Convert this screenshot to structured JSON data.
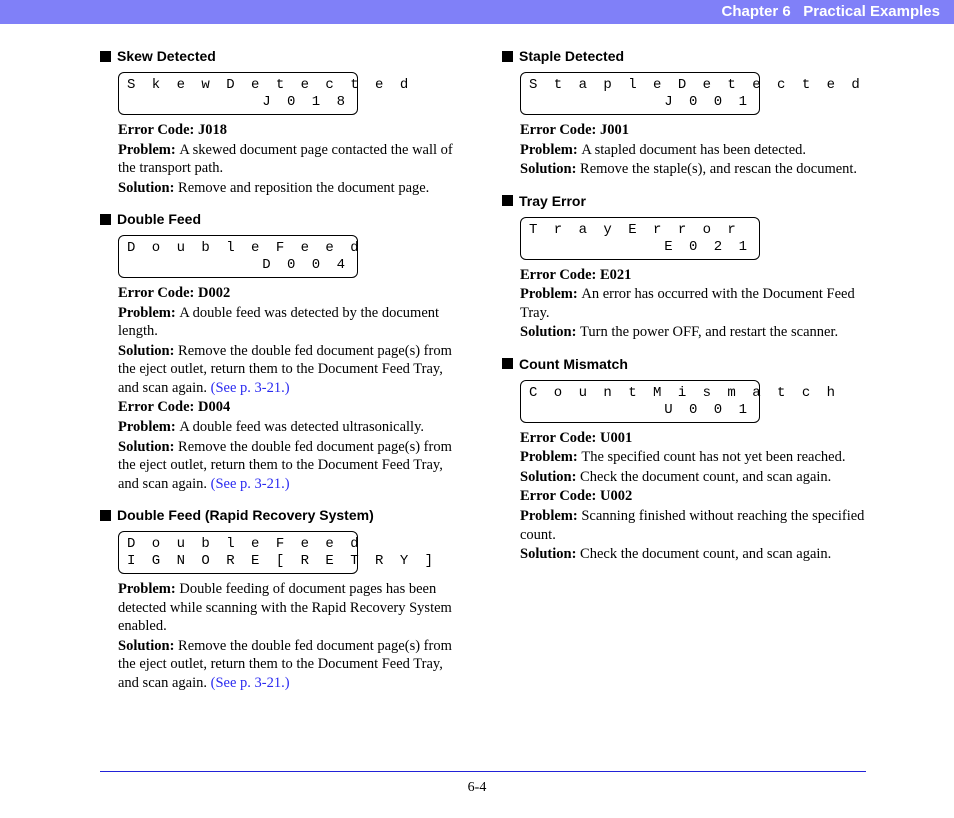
{
  "header": {
    "chapter": "Chapter 6",
    "title": "Practical Examples"
  },
  "footer": {
    "page": "6-4"
  },
  "seeRef": "(See p. 3-21.)",
  "left": [
    {
      "heading": "Skew Detected",
      "lcd": [
        "Skew Detected",
        ""
      ],
      "lcdR": [
        "",
        "J018"
      ],
      "blocks": [
        {
          "ec": "Error Code: J018",
          "p": "A skewed document page contacted the wall of the transport path.",
          "s": "Remove and reposition the document page."
        }
      ]
    },
    {
      "heading": "Double Feed",
      "lcd": [
        "Double Feed",
        ""
      ],
      "lcdR": [
        "",
        "D004"
      ],
      "blocks": [
        {
          "ec": "Error Code: D002",
          "p": "A double feed was detected by the document length.",
          "s": "Remove the double fed document page(s) from the eject outlet, return them to the Document Feed Tray, and scan again. ",
          "see": true
        },
        {
          "ec": "Error Code: D004",
          "p": "A double feed was detected ultrasonically.",
          "s": "Remove the double fed document page(s) from the eject outlet, return them to the Document Feed Tray, and scan again. ",
          "see": true
        }
      ]
    },
    {
      "heading": "Double Feed (Rapid Recovery System)",
      "lcd": [
        "Double Feed",
        " IGNORE [RETRY]"
      ],
      "lcdR": [
        "",
        ""
      ],
      "blocks": [
        {
          "ec": "",
          "p": "Double feeding of document pages has been detected while scanning with the Rapid Recovery System enabled.",
          "s": "Remove the double fed document page(s) from the eject outlet, return them to the Document Feed Tray, and scan again. ",
          "see": true
        }
      ]
    }
  ],
  "right": [
    {
      "heading": "Staple Detected",
      "lcd": [
        "Staple Detected",
        ""
      ],
      "lcdR": [
        "",
        "J001"
      ],
      "blocks": [
        {
          "ec": "Error Code: J001",
          "p": "A stapled document has been detected.",
          "s": "Remove the staple(s), and rescan the document."
        }
      ]
    },
    {
      "heading": "Tray Error",
      "lcd": [
        "Tray Error",
        ""
      ],
      "lcdR": [
        "",
        "E021"
      ],
      "blocks": [
        {
          "ec": "Error Code: E021",
          "p": "An error has occurred with the Document Feed Tray.",
          "s": "Turn the power OFF, and restart the scanner."
        }
      ]
    },
    {
      "heading": "Count Mismatch",
      "lcd": [
        "Count Mismatch",
        ""
      ],
      "lcdR": [
        "",
        "U001"
      ],
      "blocks": [
        {
          "ec": "Error Code: U001",
          "p": "The specified count has not yet been reached.",
          "s": "Check the document count, and scan again."
        },
        {
          "ec": "Error Code: U002",
          "p": "Scanning finished without reaching the specified count.",
          "s": "Check the document count, and scan again."
        }
      ]
    }
  ]
}
